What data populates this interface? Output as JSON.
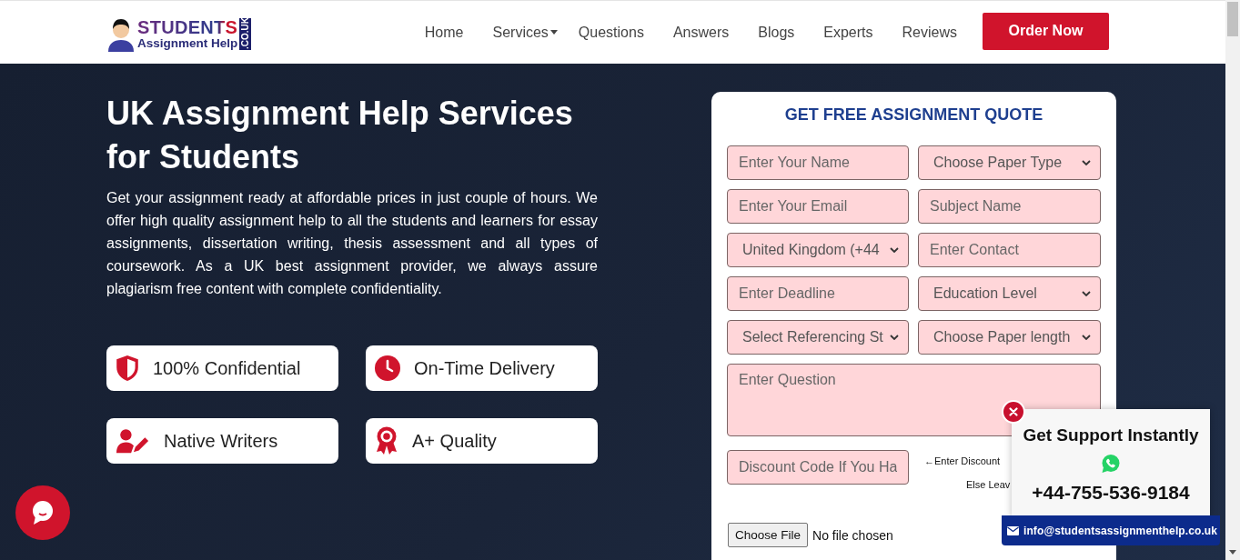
{
  "header": {
    "logo": {
      "name": "STUDENTS",
      "tagline": "Assignment Help",
      "domain": ".CO.UK"
    },
    "nav": [
      {
        "label": "Home",
        "dropdown": false
      },
      {
        "label": "Services",
        "dropdown": true
      },
      {
        "label": "Questions",
        "dropdown": false
      },
      {
        "label": "Answers",
        "dropdown": false
      },
      {
        "label": "Blogs",
        "dropdown": false
      },
      {
        "label": "Experts",
        "dropdown": false
      },
      {
        "label": "Reviews",
        "dropdown": false
      }
    ],
    "order_button": "Order Now"
  },
  "hero": {
    "title": "UK Assignment Help Services for Students",
    "description": "Get your assignment ready at affordable prices in just couple of hours. We offer high quality assignment help to all the students and learners for essay assignments, dissertation writing, thesis assessment and all types of coursework. As a UK best assignment provider, we always assure plagiarism free content with complete confidentiality.",
    "features": [
      {
        "label": "100% Confidential"
      },
      {
        "label": "On-Time Delivery"
      },
      {
        "label": "Native Writers"
      },
      {
        "label": "A+ Quality"
      }
    ]
  },
  "quote_form": {
    "title": "GET FREE ASSIGNMENT QUOTE",
    "fields": [
      {
        "kind": "input",
        "placeholder": "Enter Your Name"
      },
      {
        "kind": "select",
        "value": "Choose Paper Type"
      },
      {
        "kind": "input",
        "placeholder": "Enter Your Email"
      },
      {
        "kind": "input",
        "placeholder": "Subject Name"
      },
      {
        "kind": "select",
        "value": "United Kingdom (+44"
      },
      {
        "kind": "input",
        "placeholder": "Enter Contact"
      },
      {
        "kind": "input",
        "placeholder": "Enter Deadline"
      },
      {
        "kind": "select",
        "value": "Education Level"
      },
      {
        "kind": "select",
        "value": "Select Referencing St"
      },
      {
        "kind": "select",
        "value": "Choose Paper length"
      }
    ],
    "question": {
      "placeholder": "Enter Question"
    },
    "discount": {
      "placeholder": "Discount Code If You Ha",
      "hint": [
        "←Enter Discount",
        "Else Leav"
      ]
    },
    "file_upload": {
      "button": "Choose File",
      "status": "No file chosen"
    }
  },
  "support_popup": {
    "title": "Get Support Instantly",
    "phone": "+44-755-536-9184",
    "email": "info@studentsassignmenthelp.co.uk"
  }
}
